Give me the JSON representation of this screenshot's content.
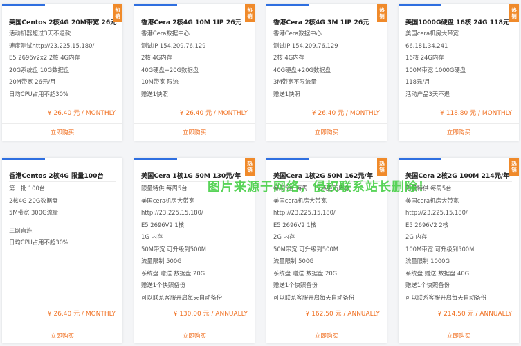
{
  "labels": {
    "hot": "热销",
    "buy": "立即购买"
  },
  "watermark": "图片来源于网络，侵权联系站长删除！",
  "cards": [
    {
      "title": "美国Centos 2核4G 20M带宽 26元",
      "hot": true,
      "features": [
        "活动机器超过3天不退款",
        "速度测试http://23.225.15.180/",
        "E5 2696v2x2 2核 4G内存",
        "20G系统盘 10G数据盘",
        "20M带宽 26元/月",
        "日均CPU占用不超30%"
      ],
      "price": "¥ 26.40 元 / MONTHLY"
    },
    {
      "title": "香港Cera 2核4G 10M 1IP 26元",
      "hot": true,
      "features": [
        "香港Cera数据中心",
        "测试IP 154.209.76.129",
        "2核 4G内存",
        "40G硬盘+20G数据盘",
        "10M带宽 限流",
        "赠送1快照"
      ],
      "price": "¥ 26.40 元 / MONTHLY"
    },
    {
      "title": "香港Cera 2核4G 3M 1IP 26元",
      "hot": true,
      "features": [
        "香港Cera数据中心",
        "测试IP 154.209.76.129",
        "2核 4G内存",
        "40G硬盘+20G数据盘",
        "3M带宽不限流量",
        "赠送1快照"
      ],
      "price": "¥ 26.40 元 / MONTHLY"
    },
    {
      "title": "美国1000G硬盘 16核 24G 118元",
      "hot": true,
      "features": [
        "美国cera机房大带宽",
        "66.181.34.241",
        "16核 24G内存",
        "100M带宽 1000G硬盘",
        "118元/月",
        "活动产品3天不退"
      ],
      "price": "¥ 118.80 元 / MONTHLY"
    },
    {
      "title": "香港Centos 2核4G 限量100台",
      "hot": false,
      "features": [
        "第一批 100台",
        "2核4G 20G数据盘",
        "5M带宽 300G流量",
        "",
        "三网直连",
        "日均CPU占用不超30%"
      ],
      "price": "¥ 26.40 元 / MONTHLY"
    },
    {
      "title": "美国Cera 1核1G 50M 130元/年",
      "hot": true,
      "features": [
        "限量特供 每周5台",
        "美国cera机房大带宽",
        "http://23.225.15.180/",
        "E5 2696V2 1核",
        "1G 内存",
        "50M带宽 可升级到500M",
        "流量限制 500G",
        "系统盘 赠送 数据盘 20G",
        "赠送1个快照备份",
        "可以联系客服开启每天自动备份"
      ],
      "price": "¥ 130.00 元 / ANNUALLY"
    },
    {
      "title": "美国Cera 1核2G 50M 162元/年",
      "hot": true,
      "features": [
        "每周5台 每周一12点更新库存",
        "美国cera机房大带宽",
        "http://23.225.15.180/",
        "E5 2696V2 1核",
        "2G 内存",
        "50M带宽 可升级到500M",
        "流量限制 500G",
        "系统盘 赠送 数据盘 20G",
        "赠送1个快照备份",
        "可以联系客服开启每天自动备份"
      ],
      "price": "¥ 162.50 元 / ANNUALLY"
    },
    {
      "title": "美国Cera 2核2G 100M 214元/年",
      "hot": true,
      "features": [
        "限量特供 每周5台",
        "美国cera机房大带宽",
        "http://23.225.15.180/",
        "E5 2696V2 2核",
        "2G 内存",
        "100M带宽 可升级到500M",
        "流量限制 1000G",
        "系统盘 赠送 数据盘 40G",
        "赠送1个快照备份",
        "可以联系客服开启每天自动备份"
      ],
      "price": "¥ 214.50 元 / ANNUALLY"
    }
  ]
}
